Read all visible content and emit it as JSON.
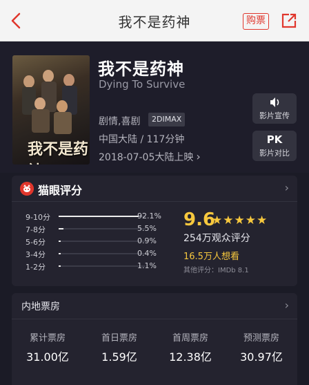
{
  "nav": {
    "title": "我不是药神",
    "buy_label": "购票"
  },
  "movie": {
    "poster_title": "我不是药神",
    "title": "我不是药神",
    "english_title": "Dying To Survive",
    "genre": "剧情,喜剧",
    "format_badge": "2DIMAX",
    "region_runtime": "中国大陆 / 117分钟",
    "release": "2018-07-05大陆上映"
  },
  "side_buttons": [
    {
      "icon": "speaker-icon",
      "label": "影片宣传"
    },
    {
      "icon_text": "PK",
      "label": "影片对比"
    }
  ],
  "rating": {
    "header": "猫眼评分",
    "distribution": [
      {
        "label": "9-10分",
        "pct": "92.1%",
        "value": 92.1
      },
      {
        "label": "7-8分",
        "pct": "5.5%",
        "value": 5.5
      },
      {
        "label": "5-6分",
        "pct": "0.9%",
        "value": 0.9
      },
      {
        "label": "3-4分",
        "pct": "0.4%",
        "value": 0.4
      },
      {
        "label": "1-2分",
        "pct": "1.1%",
        "value": 1.1
      }
    ],
    "score": "9.6",
    "stars": "★★★★★",
    "votes": "254万观众评分",
    "want": "16.5万人想看",
    "other": "其他评分：IMDb 8.1"
  },
  "box_office": {
    "header": "内地票房",
    "stats": [
      {
        "label": "累计票房",
        "value": "31.00亿"
      },
      {
        "label": "首日票房",
        "value": "1.59亿"
      },
      {
        "label": "首周票房",
        "value": "12.38亿"
      },
      {
        "label": "预测票房",
        "value": "30.97亿"
      }
    ]
  },
  "colors": {
    "accent_red": "#e0362c",
    "gold": "#f7c83e",
    "background": "#1b1b26",
    "card": "#24232f"
  }
}
